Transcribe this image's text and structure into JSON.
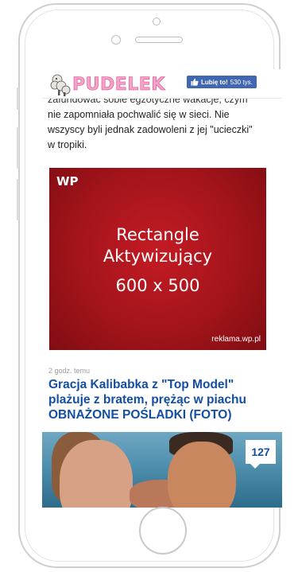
{
  "header": {
    "logo_text": "PUDELEK",
    "fb_like_label": "Lubię to!",
    "fb_like_count": "530 tys."
  },
  "article": {
    "clipped_line": "zafundować sobie egzotyczne wakacje, czym",
    "line2": "nie zapomniała pochwalić się w sieci. Nie",
    "line3": "wszyscy byli jednak zadowoleni z jej \"ucieczki\"",
    "line4": "w tropiki."
  },
  "ad": {
    "brand_logo": "WP",
    "line1": "Rectangle",
    "line2": "Aktywizujący",
    "line3": "600 x 500",
    "credit": "reklama.wp.pl",
    "bg_color": "#b0171f"
  },
  "news_item": {
    "time_ago": "2 godz. temu",
    "headline": "Gracja Kalibabka z \"Top Model\" plażuje z bratem, prężąc w piachu OBNAŻONE POŚLADKI (FOTO)",
    "photo_count": "127",
    "headline_color": "#134ea2"
  }
}
